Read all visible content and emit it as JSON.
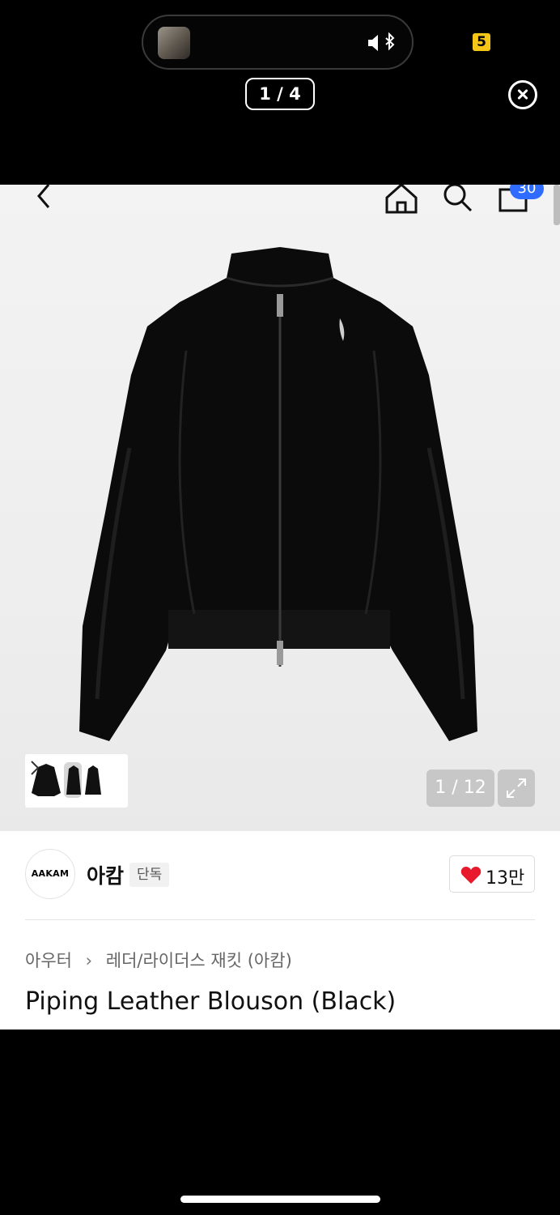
{
  "viewer": {
    "page_counter": "1 / 4",
    "notification_badge": "5",
    "close_icon": "circle-x-icon",
    "audio_icon": "speaker-bluetooth-icon"
  },
  "nav": {
    "back_icon": "chevron-left-icon",
    "home_icon": "home-icon",
    "search_icon": "search-icon",
    "cart_icon": "shopping-bag-icon",
    "cart_count": "30"
  },
  "gallery": {
    "image_counter": "1 / 12",
    "expand_icon": "expand-icon"
  },
  "brand": {
    "logo_text": "AAKAM",
    "name": "아캄",
    "tag": "단독",
    "like_count": "13만",
    "heart_color": "#e8192c"
  },
  "breadcrumb": {
    "category": "아우터",
    "separator": "›",
    "subcategory": "레더/라이더스 재킷 (아캄)"
  },
  "product": {
    "title": "Piping Leather Blouson (Black)"
  }
}
